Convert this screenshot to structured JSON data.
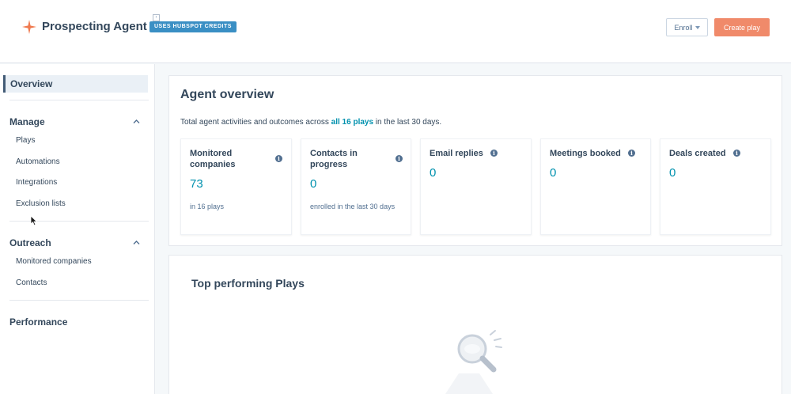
{
  "header": {
    "app_title": "Prospecting Agent",
    "badge": "USES HUBSPOT CREDITS",
    "enroll_label": "Enroll",
    "create_label": "Create play",
    "logo_icon": "sparkle-icon",
    "accent_color": "#f08a6a"
  },
  "sidebar": {
    "overview_label": "Overview",
    "sections": [
      {
        "title": "Manage",
        "items": [
          "Plays",
          "Automations",
          "Integrations",
          "Exclusion lists"
        ]
      },
      {
        "title": "Outreach",
        "items": [
          "Monitored companies",
          "Contacts"
        ]
      },
      {
        "title": "Performance",
        "items": []
      }
    ]
  },
  "overview": {
    "title": "Agent overview",
    "subtitle_pre": "Total agent activities and outcomes across ",
    "subtitle_link": "all 16 plays",
    "subtitle_post": " in the last 30 days.",
    "metrics": [
      {
        "label": "Monitored companies",
        "value": "73",
        "note": "in 16 plays"
      },
      {
        "label": "Contacts in progress",
        "value": "0",
        "note": "enrolled in the last 30 days"
      },
      {
        "label": "Email replies",
        "value": "0",
        "note": ""
      },
      {
        "label": "Meetings booked",
        "value": "0",
        "note": ""
      },
      {
        "label": "Deals created",
        "value": "0",
        "note": ""
      }
    ]
  },
  "top_plays": {
    "title": "Top performing Plays"
  }
}
